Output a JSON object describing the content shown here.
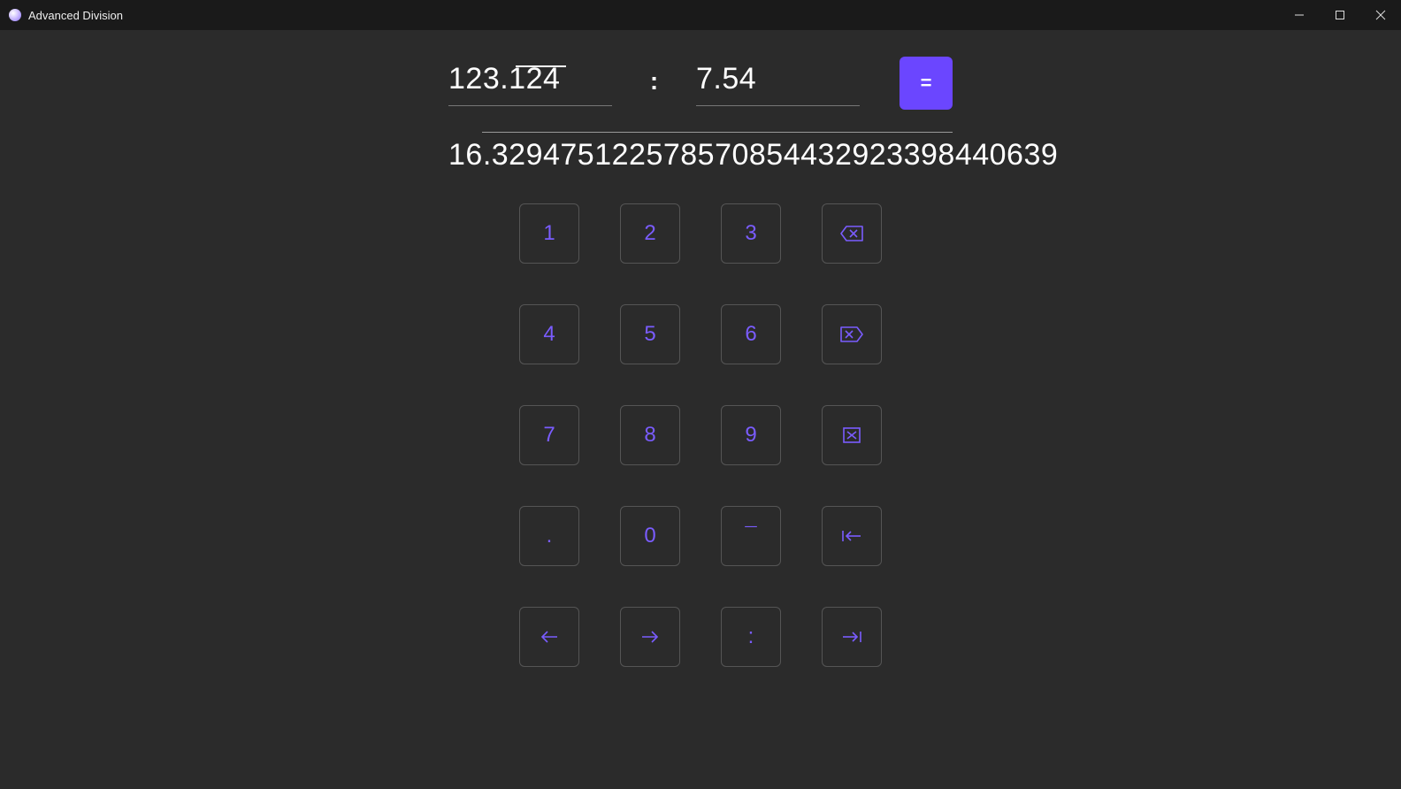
{
  "window": {
    "title": "Advanced Division"
  },
  "inputs": {
    "dividend": "123.124",
    "dividend_overline_start_ch": 4,
    "dividend_overline_len_ch": 3,
    "operator": ":",
    "divisor": "7.54",
    "equals": "="
  },
  "result": "16.3294751225785708544329233984406̅3̅9̅",
  "result_plain": "16.329475122578570854432923398440639",
  "keypad": {
    "k1": "1",
    "k2": "2",
    "k3": "3",
    "k4": "4",
    "k5": "5",
    "k6": "6",
    "k7": "7",
    "k8": "8",
    "k9": "9",
    "k0": "0",
    "dot": ".",
    "macron": "¯",
    "colon": ":"
  },
  "icons": {
    "backspace": "backspace-icon",
    "delete": "delete-icon",
    "clear": "clear-icon",
    "prev_field": "arrow-left-to-line-icon",
    "left": "arrow-left-icon",
    "right": "arrow-right-icon",
    "next_field": "arrow-right-to-line-icon"
  },
  "colors": {
    "accent": "#6b46ff",
    "key_text": "#7a5cff",
    "bg": "#2b2b2b",
    "titlebar": "#1a1a1a"
  }
}
